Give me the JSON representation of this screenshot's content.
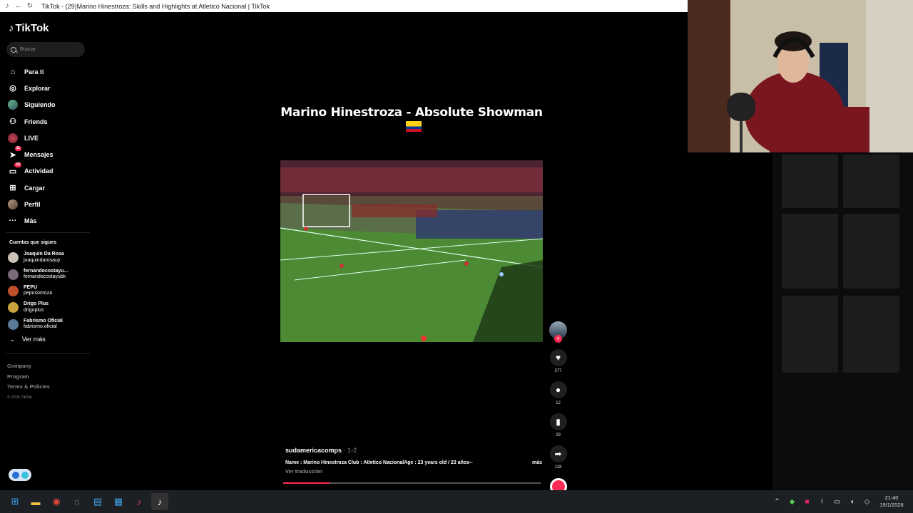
{
  "browser": {
    "title": "TikTok - (29)Marino Hinestroza: Skills and Highlights at Atletico Nacional | TikTok"
  },
  "sidebar": {
    "brand": "TikTok",
    "search_placeholder": "Buscar",
    "nav": [
      {
        "label": "Para ti",
        "icon": "home-icon"
      },
      {
        "label": "Explorar",
        "icon": "compass-icon"
      },
      {
        "label": "Siguiendo",
        "icon": "following-avatar-icon"
      },
      {
        "label": "Friends",
        "icon": "friends-icon"
      },
      {
        "label": "LIVE",
        "icon": "live-icon"
      },
      {
        "label": "Mensajes",
        "icon": "messages-icon",
        "badge": "11"
      },
      {
        "label": "Actividad",
        "icon": "activity-icon",
        "badge": "18"
      },
      {
        "label": "Cargar",
        "icon": "upload-icon"
      },
      {
        "label": "Perfil",
        "icon": "profile-avatar-icon"
      },
      {
        "label": "Más",
        "icon": "more-icon"
      }
    ],
    "following_title": "Cuentas que sigues",
    "following": [
      {
        "name": "Joaquín Da Rosa",
        "handle": "joaquindarosauy"
      },
      {
        "name": "fernandocostayu...",
        "handle": "fernandocostayubk"
      },
      {
        "name": "PEPU",
        "handle": "pepusomoza"
      },
      {
        "name": "Drigo Plus",
        "handle": "drigoplus"
      },
      {
        "name": "Fabrismo Oficial",
        "handle": "fabrismo.oficial"
      }
    ],
    "see_more": "Ver más",
    "footer": [
      "Company",
      "Program",
      "Terms & Policies"
    ],
    "copyright": "© 2026 TikTok"
  },
  "video": {
    "overlay_title": "Marino Hinestroza - Absolute Showman",
    "author": "sudamericacomps",
    "date": "· 1-2",
    "description": "Name : Marino Hinestroza Club : Atletico NacionalAge : 23 years old / 23 años--",
    "more": "más",
    "translate": "Ver traducción",
    "progress": 0.18
  },
  "actions": {
    "likes": "377",
    "comments": "12",
    "saves": "29",
    "shares": "128"
  },
  "taskbar": {
    "time": "21:40",
    "date": "19/1/2026"
  }
}
